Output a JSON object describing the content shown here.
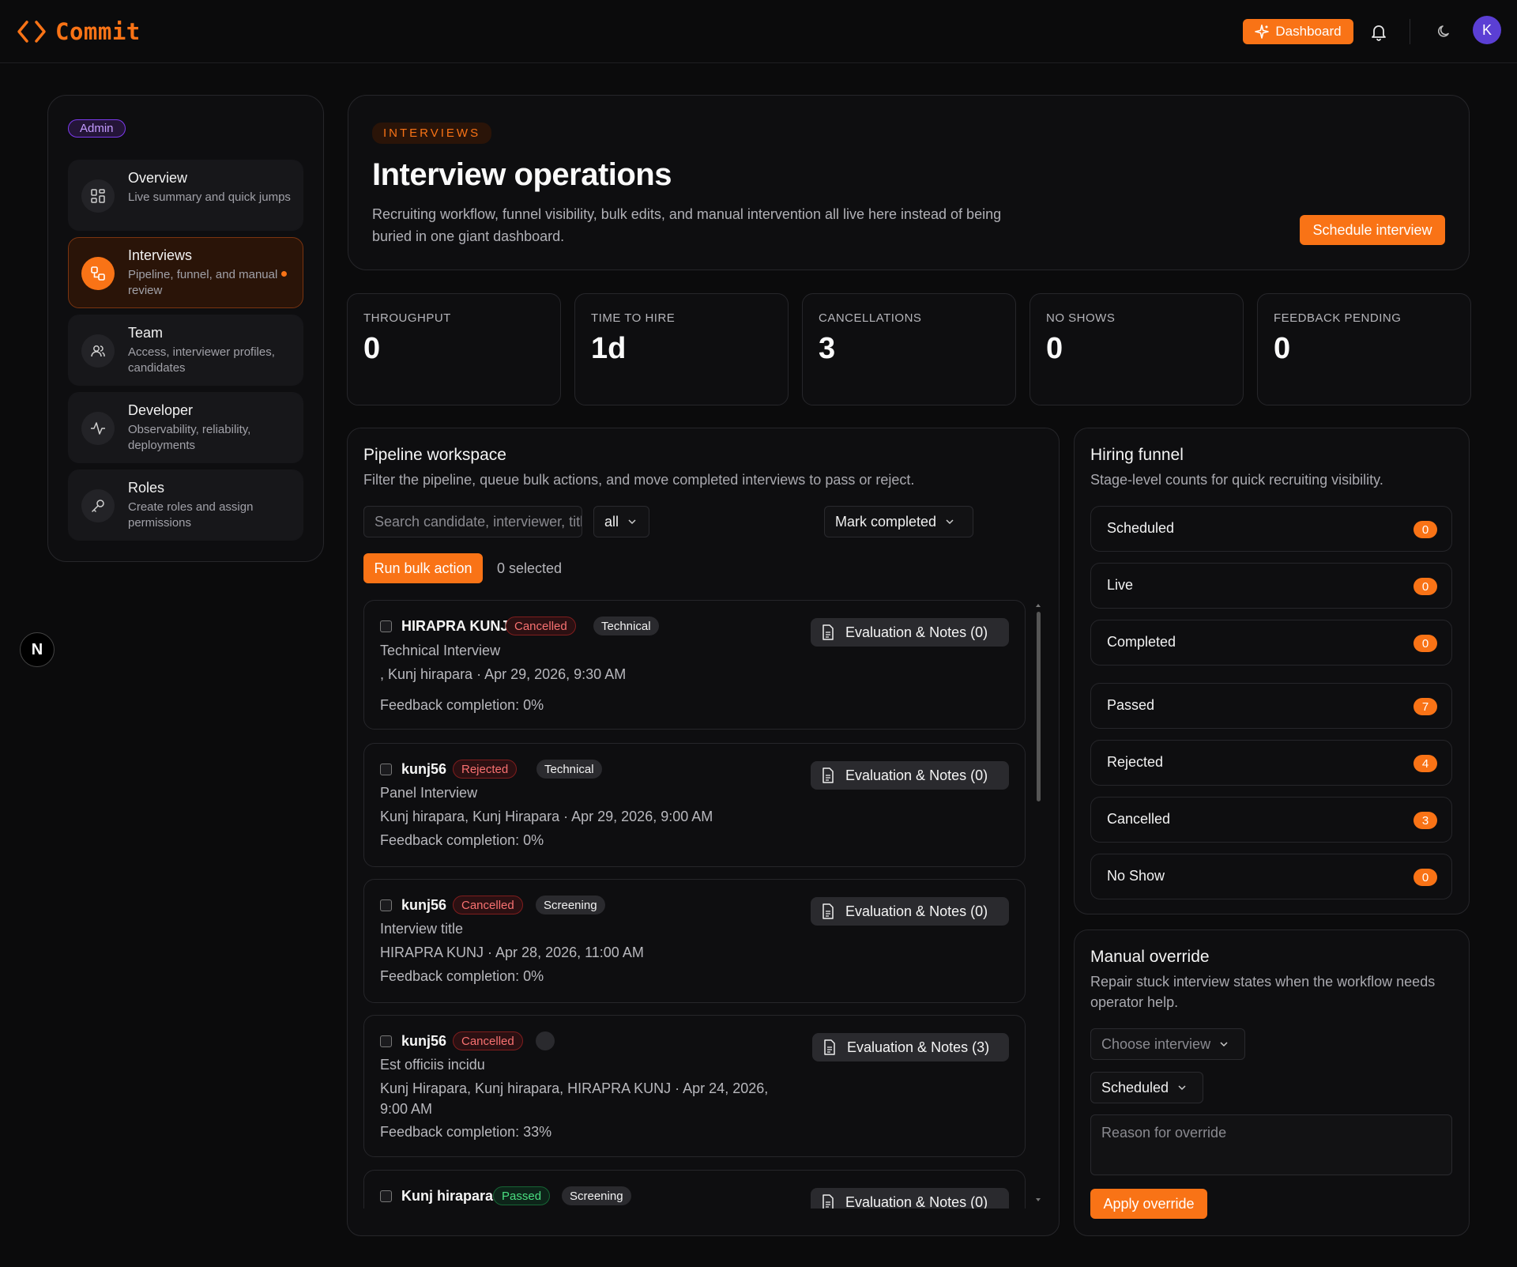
{
  "app": {
    "name": "Commit"
  },
  "header": {
    "dashboard_label": "Dashboard",
    "avatar_initial": "K"
  },
  "sidebar": {
    "role_badge": "Admin",
    "items": [
      {
        "title": "Overview",
        "desc": "Live summary and quick jumps",
        "icon": "grid-icon"
      },
      {
        "title": "Interviews",
        "desc": "Pipeline, funnel, and manual review",
        "icon": "workflow-icon",
        "active": true
      },
      {
        "title": "Team",
        "desc": "Access, interviewer profiles, candidates",
        "icon": "users-icon"
      },
      {
        "title": "Developer",
        "desc": "Observability, reliability, deployments",
        "icon": "activity-icon"
      },
      {
        "title": "Roles",
        "desc": "Create roles and assign permissions",
        "icon": "key-icon"
      }
    ],
    "n_logo": "N"
  },
  "hero": {
    "eyebrow": "INTERVIEWS",
    "title": "Interview operations",
    "desc": "Recruiting workflow, funnel visibility, bulk edits, and manual intervention all live here instead of being buried in one giant dashboard.",
    "cta": "Schedule interview"
  },
  "stats": [
    {
      "label": "THROUGHPUT",
      "value": "0"
    },
    {
      "label": "TIME TO HIRE",
      "value": "1d"
    },
    {
      "label": "CANCELLATIONS",
      "value": "3"
    },
    {
      "label": "NO SHOWS",
      "value": "0"
    },
    {
      "label": "FEEDBACK PENDING",
      "value": "0"
    }
  ],
  "pipeline": {
    "title": "Pipeline workspace",
    "desc": "Filter the pipeline, queue bulk actions, and move completed interviews to pass or reject.",
    "search_placeholder": "Search candidate, interviewer, title",
    "filter_value": "all",
    "bulk_action_value": "Mark completed",
    "run_label": "Run bulk action",
    "selected_text": "0 selected",
    "cards": [
      {
        "candidate": "HIRAPRA KUNJ",
        "status": "Cancelled",
        "type": "Technical",
        "title": "Technical Interview",
        "meta": ", Kunj hirapara · Apr 29, 2026, 9:30 AM",
        "feedback": "Feedback completion: 0%",
        "eval": "Evaluation & Notes  (0)"
      },
      {
        "candidate": "kunj56",
        "status": "Rejected",
        "type": "Technical",
        "title": "Panel Interview",
        "meta": "Kunj hirapara, Kunj Hirapara · Apr 29, 2026, 9:00 AM",
        "feedback": "Feedback completion: 0%",
        "eval": "Evaluation & Notes  (0)"
      },
      {
        "candidate": "kunj56",
        "status": "Cancelled",
        "type": "Screening",
        "title": "Interview title",
        "meta": "HIRAPRA KUNJ · Apr 28, 2026, 11:00 AM",
        "feedback": "Feedback completion: 0%",
        "eval": "Evaluation & Notes  (0)"
      },
      {
        "candidate": "kunj56",
        "status": "Cancelled",
        "type": "",
        "title": "Est officiis incidu",
        "meta": "Kunj Hirapara, Kunj hirapara, HIRAPRA KUNJ · Apr 24, 2026, 9:00 AM",
        "feedback": "Feedback completion: 33%",
        "eval": "Evaluation & Notes  (3)"
      },
      {
        "candidate": "Kunj hirapara",
        "status": "Passed",
        "type": "Screening",
        "title": "",
        "meta": "",
        "feedback": "",
        "eval": "Evaluation & Notes  (0)"
      }
    ]
  },
  "funnel": {
    "title": "Hiring funnel",
    "desc": "Stage-level counts for quick recruiting visibility.",
    "stages": [
      {
        "label": "Scheduled",
        "count": "0"
      },
      {
        "label": "Live",
        "count": "0"
      },
      {
        "label": "Completed",
        "count": "0"
      },
      {
        "label": "Passed",
        "count": "7"
      },
      {
        "label": "Rejected",
        "count": "4"
      },
      {
        "label": "Cancelled",
        "count": "3"
      },
      {
        "label": "No Show",
        "count": "0"
      }
    ]
  },
  "override": {
    "title": "Manual override",
    "desc": "Repair stuck interview states when the workflow needs operator help.",
    "choose_placeholder": "Choose interview",
    "state_value": "Scheduled",
    "reason_placeholder": "Reason for override",
    "apply_label": "Apply override"
  },
  "colors": {
    "accent": "#f97316",
    "background": "#0b0b0c",
    "avatar": "#5b3fd4",
    "admin_badge": "#7c3aed"
  }
}
